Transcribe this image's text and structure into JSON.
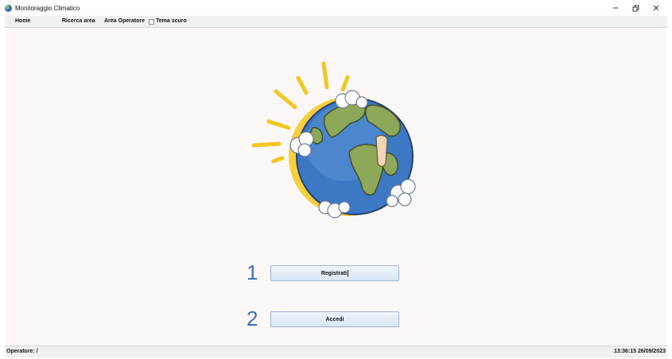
{
  "window": {
    "title": "Monitoraggio Climatico",
    "controls": [
      "minimize",
      "maximize",
      "close"
    ]
  },
  "menu": {
    "home": "Home",
    "ricerca_area": "Ricerca area",
    "area_operatore": "Area Operatore",
    "tema_scuro": "Tema scuro",
    "tema_scuro_checked": false
  },
  "main": {
    "illustration": "earth-with-sun-icon",
    "steps": [
      {
        "number": "1",
        "button_label": "Registrati"
      },
      {
        "number": "2",
        "button_label": "Accedi"
      }
    ]
  },
  "status": {
    "operator": "Operatore: /",
    "datetime": "13:36:15 26/09/2023"
  },
  "colors": {
    "content_background": "#fdf8f8",
    "step_number": "#3b6fb8",
    "button_border": "#9fb5cf"
  }
}
